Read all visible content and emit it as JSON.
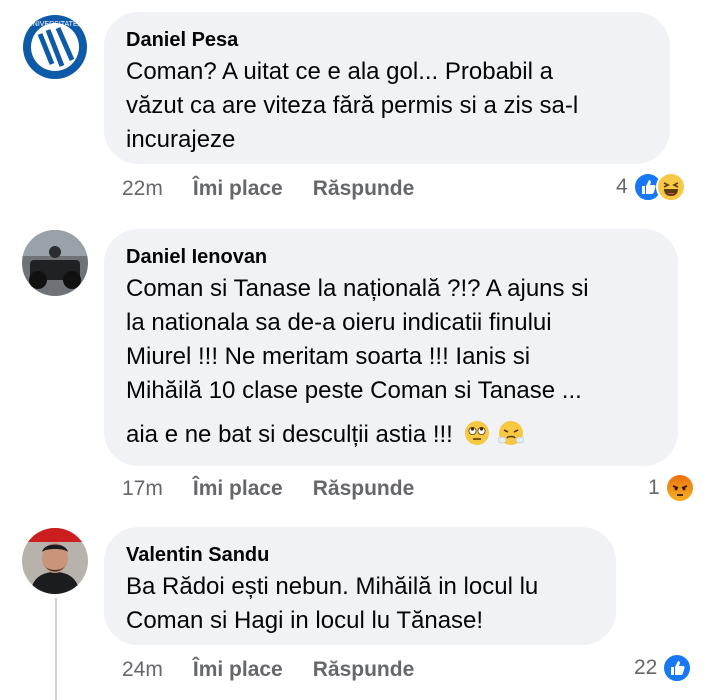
{
  "comments": [
    {
      "author": "Daniel Pesa",
      "lines": [
        "Coman? A uitat ce e ala gol... Probabil a",
        "văzut ca are viteza fără permis si a zis sa-l",
        "incurajeze"
      ],
      "time": "22m",
      "like_label": "Îmi place",
      "reply_label": "Răspunde",
      "reaction_count": "4",
      "reactions": [
        "like-icon",
        "haha-icon"
      ]
    },
    {
      "author": "Daniel Ienovan",
      "lines": [
        "Coman si Tanase  la națională ?!? A ajuns si",
        "la nationala sa de-a oieru indicatii finului",
        "Miurel  !!! Ne meritam soarta !!! Ianis si",
        "Mihăilă 10 clase peste Coman si Tanase ...",
        "aia e ne bat si desculții astia !!!"
      ],
      "inline_emojis": [
        "face-with-rolling-eyes-icon",
        "face-with-steam-icon"
      ],
      "time": "17m",
      "like_label": "Îmi place",
      "reply_label": "Răspunde",
      "reaction_count": "1",
      "reactions": [
        "angry-icon"
      ]
    },
    {
      "author": "Valentin Sandu",
      "lines": [
        "Ba Rădoi ești nebun. Mihăilă in locul lu",
        "Coman si Hagi in locul lu Tănase!"
      ],
      "time": "24m",
      "like_label": "Îmi place",
      "reply_label": "Răspunde",
      "reaction_count": "22",
      "reactions": [
        "like-icon"
      ]
    }
  ],
  "colors": {
    "bubble": "#f0f2f5",
    "meta_text": "#65676b",
    "like_blue": "#1877f2",
    "haha_yellow": "#f7c843",
    "angry_orange": "#e9710f"
  }
}
